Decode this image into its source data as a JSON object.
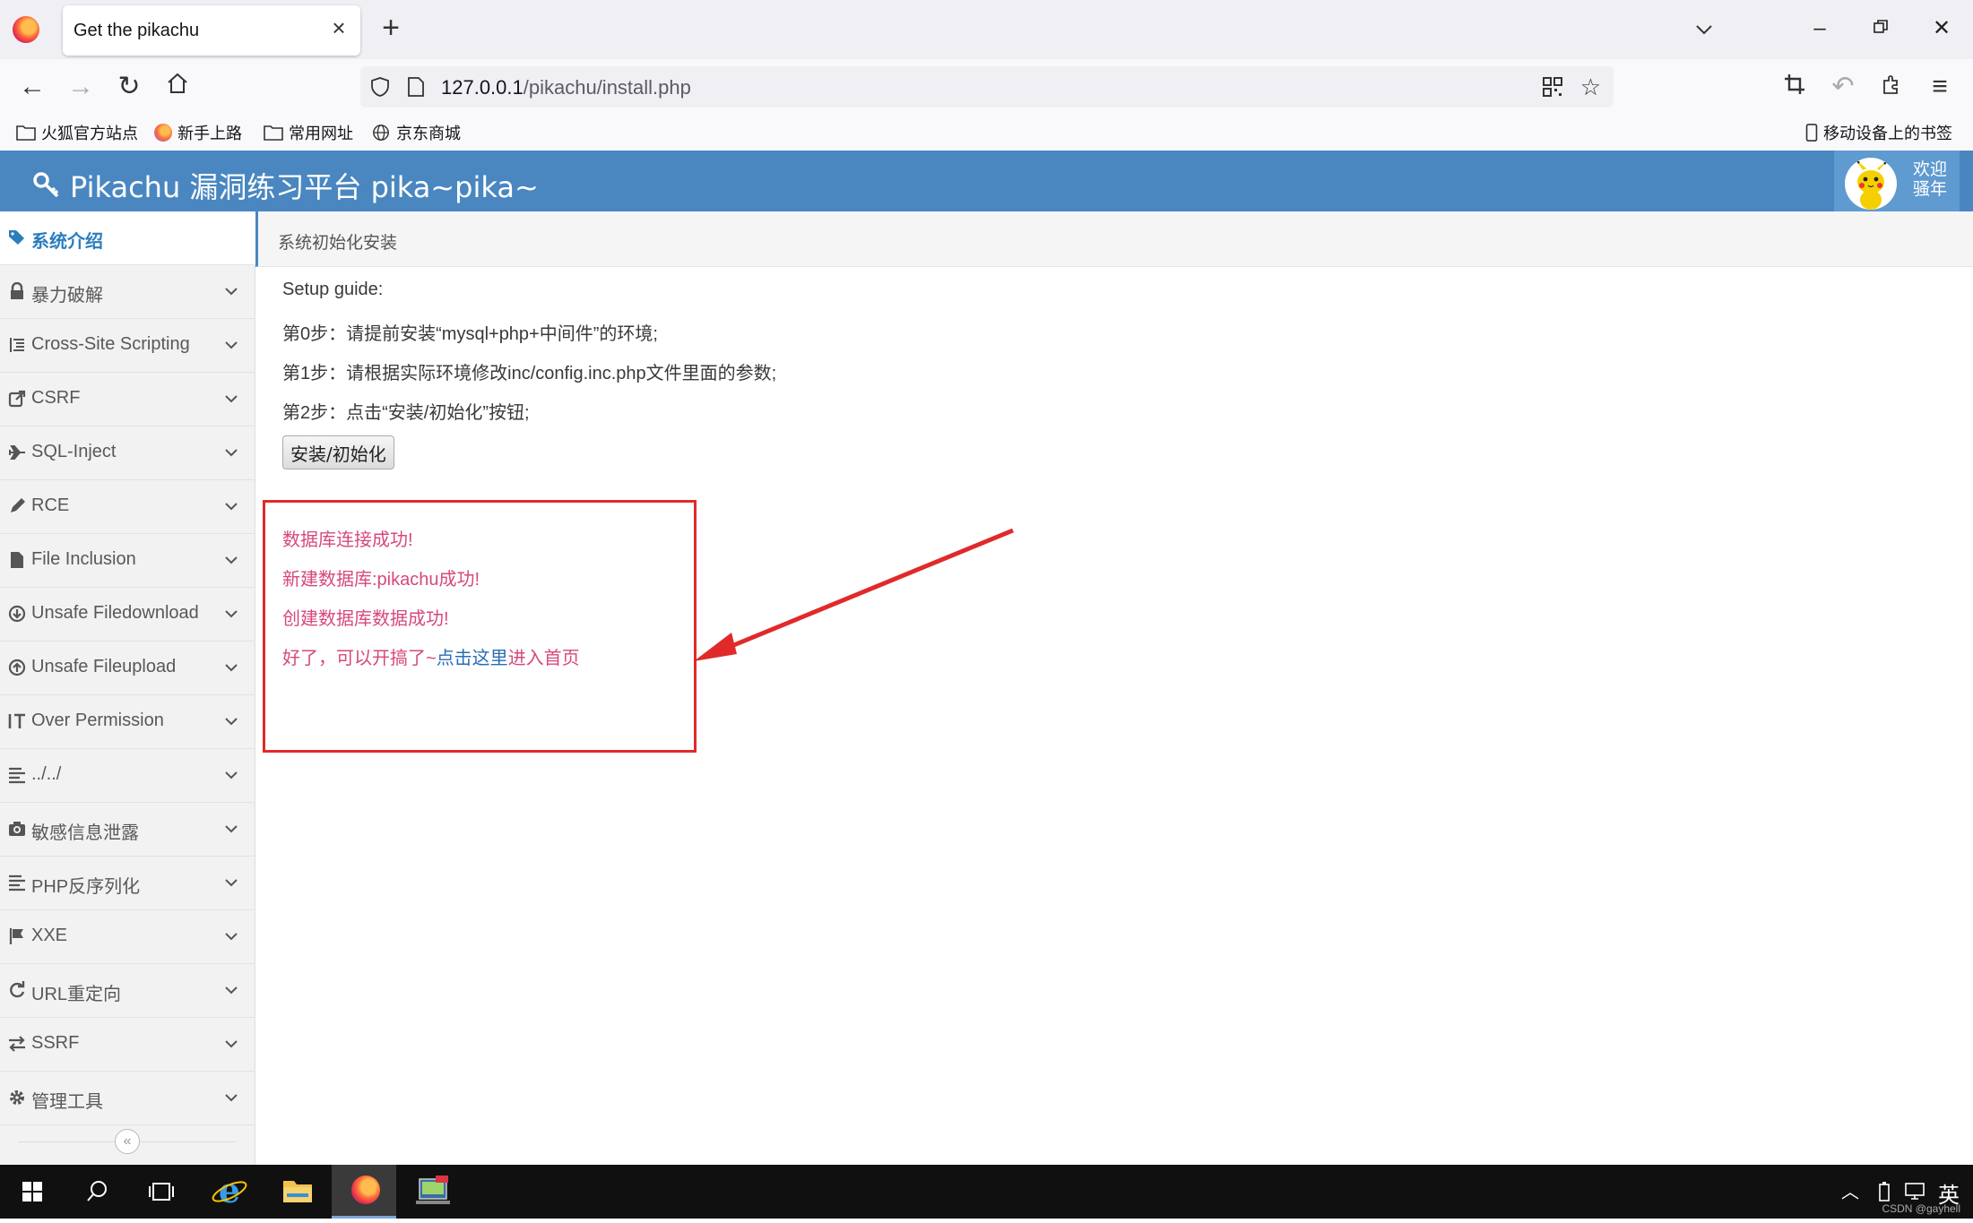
{
  "browser": {
    "tab_title": "Get the pikachu",
    "url_host": "127.0.0.1",
    "url_path": "/pikachu/install.php",
    "bookmarks": [
      "火狐官方站点",
      "新手上路",
      "常用网址",
      "京东商城"
    ],
    "mobile_bookmarks": "移动设备上的书签"
  },
  "app": {
    "title": "Pikachu 漏洞练习平台 pika~pika~",
    "welcome_line1": "欢迎",
    "welcome_line2": "骚年"
  },
  "sidebar": {
    "items": [
      {
        "label": "系统介绍",
        "icon": "tags-icon"
      },
      {
        "label": "暴力破解",
        "icon": "lock-icon"
      },
      {
        "label": "Cross-Site Scripting",
        "icon": "list-indent-icon"
      },
      {
        "label": "CSRF",
        "icon": "share-icon"
      },
      {
        "label": "SQL-Inject",
        "icon": "plane-icon"
      },
      {
        "label": "RCE",
        "icon": "pencil-icon"
      },
      {
        "label": "File Inclusion",
        "icon": "file-icon"
      },
      {
        "label": "Unsafe Filedownload",
        "icon": "download-circle-icon"
      },
      {
        "label": "Unsafe Fileupload",
        "icon": "upload-circle-icon"
      },
      {
        "label": "Over Permission",
        "icon": "text-height-icon"
      },
      {
        "label": "../../",
        "icon": "align-left-icon"
      },
      {
        "label": "敏感信息泄露",
        "icon": "camera-icon"
      },
      {
        "label": "PHP反序列化",
        "icon": "align-left-icon"
      },
      {
        "label": "XXE",
        "icon": "flag-icon"
      },
      {
        "label": "URL重定向",
        "icon": "refresh-icon"
      },
      {
        "label": "SSRF",
        "icon": "exchange-icon"
      },
      {
        "label": "管理工具",
        "icon": "cog-icon"
      }
    ]
  },
  "main": {
    "breadcrumb": "系统初始化安装",
    "guide_title": "Setup guide:",
    "step0": "第0步：请提前安装“mysql+php+中间件”的环境;",
    "step1": "第1步：请根据实际环境修改inc/config.inc.php文件里面的参数;",
    "step2": "第2步：点击“安装/初始化”按钮;",
    "install_button": "安装/初始化",
    "messages": {
      "db_connect": "数据库连接成功!",
      "db_create": "新建数据库:pikachu成功!",
      "data_create": "创建数据库数据成功!",
      "done_prefix": "好了，可以开搞了~",
      "done_link": "点击这里",
      "done_suffix": "进入首页"
    }
  },
  "taskbar": {
    "ime": "英",
    "watermark": "CSDN @gayhell"
  },
  "colors": {
    "header_blue": "#4a87c0",
    "message_pink": "#d6487e",
    "annotation_red": "#e02a2a"
  }
}
